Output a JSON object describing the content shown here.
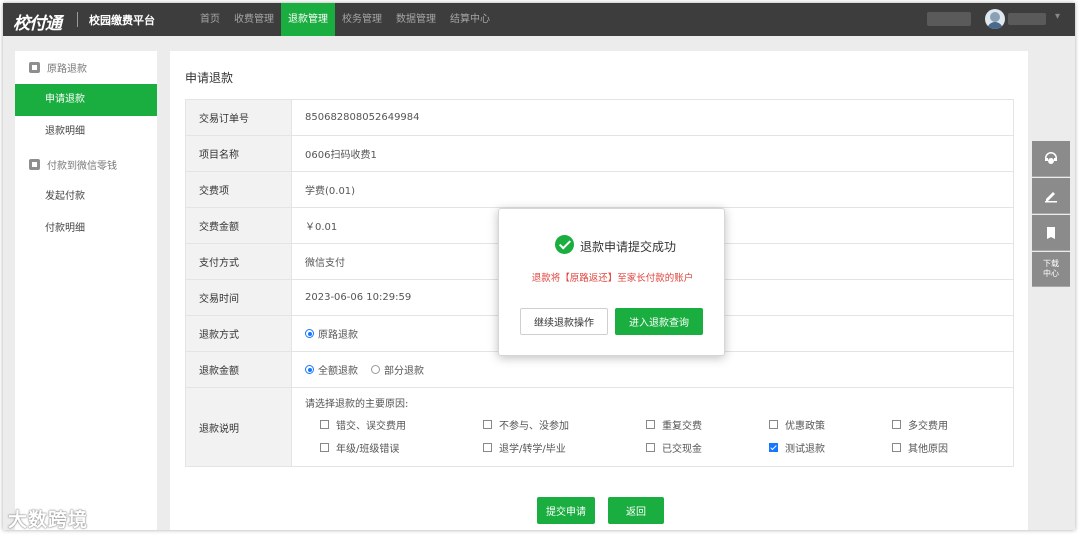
{
  "header": {
    "logo": "校付通",
    "platform": "校园缴费平台",
    "nav": [
      "首页",
      "收费管理",
      "退款管理",
      "校务管理",
      "数据管理",
      "结算中心"
    ],
    "active_nav_index": 2,
    "caret": "▾"
  },
  "sidebar": {
    "group1": "原路退款",
    "group1_items": [
      "申请退款",
      "退款明细"
    ],
    "group2": "付款到微信零钱",
    "group2_items": [
      "发起付款",
      "付款明细"
    ]
  },
  "main": {
    "title": "申请退款",
    "rows": [
      {
        "label": "交易订单号",
        "value": "850682808052649984"
      },
      {
        "label": "项目名称",
        "value": "0606扫码收费1"
      },
      {
        "label": "交费项",
        "value": "学费(0.01)"
      },
      {
        "label": "交费金额",
        "value": "￥0.01"
      },
      {
        "label": "支付方式",
        "value": "微信支付"
      },
      {
        "label": "交易时间",
        "value": "2023-06-06 10:29:59"
      }
    ],
    "refund_method_label": "退款方式",
    "refund_method_option": "原路退款",
    "refund_amount_label": "退款金额",
    "refund_amount_options": [
      "全额退款",
      "部分退款"
    ],
    "refund_desc_label": "退款说明",
    "reason_prompt": "请选择退款的主要原因:",
    "reasons": [
      {
        "label": "错交、误交费用",
        "checked": false
      },
      {
        "label": "不参与、没参加",
        "checked": false
      },
      {
        "label": "重复交费",
        "checked": false
      },
      {
        "label": "优惠政策",
        "checked": false
      },
      {
        "label": "多交费用",
        "checked": false
      },
      {
        "label": "年级/班级错误",
        "checked": false
      },
      {
        "label": "退学/转学/毕业",
        "checked": false
      },
      {
        "label": "已交现金",
        "checked": false
      },
      {
        "label": "测试退款",
        "checked": true
      },
      {
        "label": "其他原因",
        "checked": false
      }
    ],
    "submit_label": "提交申请",
    "back_label": "返回"
  },
  "dialog": {
    "title": "退款申请提交成功",
    "message": "退款将【原路返还】至家长付款的账户",
    "continue_label": "继续退款操作",
    "query_label": "进入退款查询"
  },
  "float_bar": {
    "download_line1": "下载",
    "download_line2": "中心"
  },
  "watermark": "大数跨境"
}
